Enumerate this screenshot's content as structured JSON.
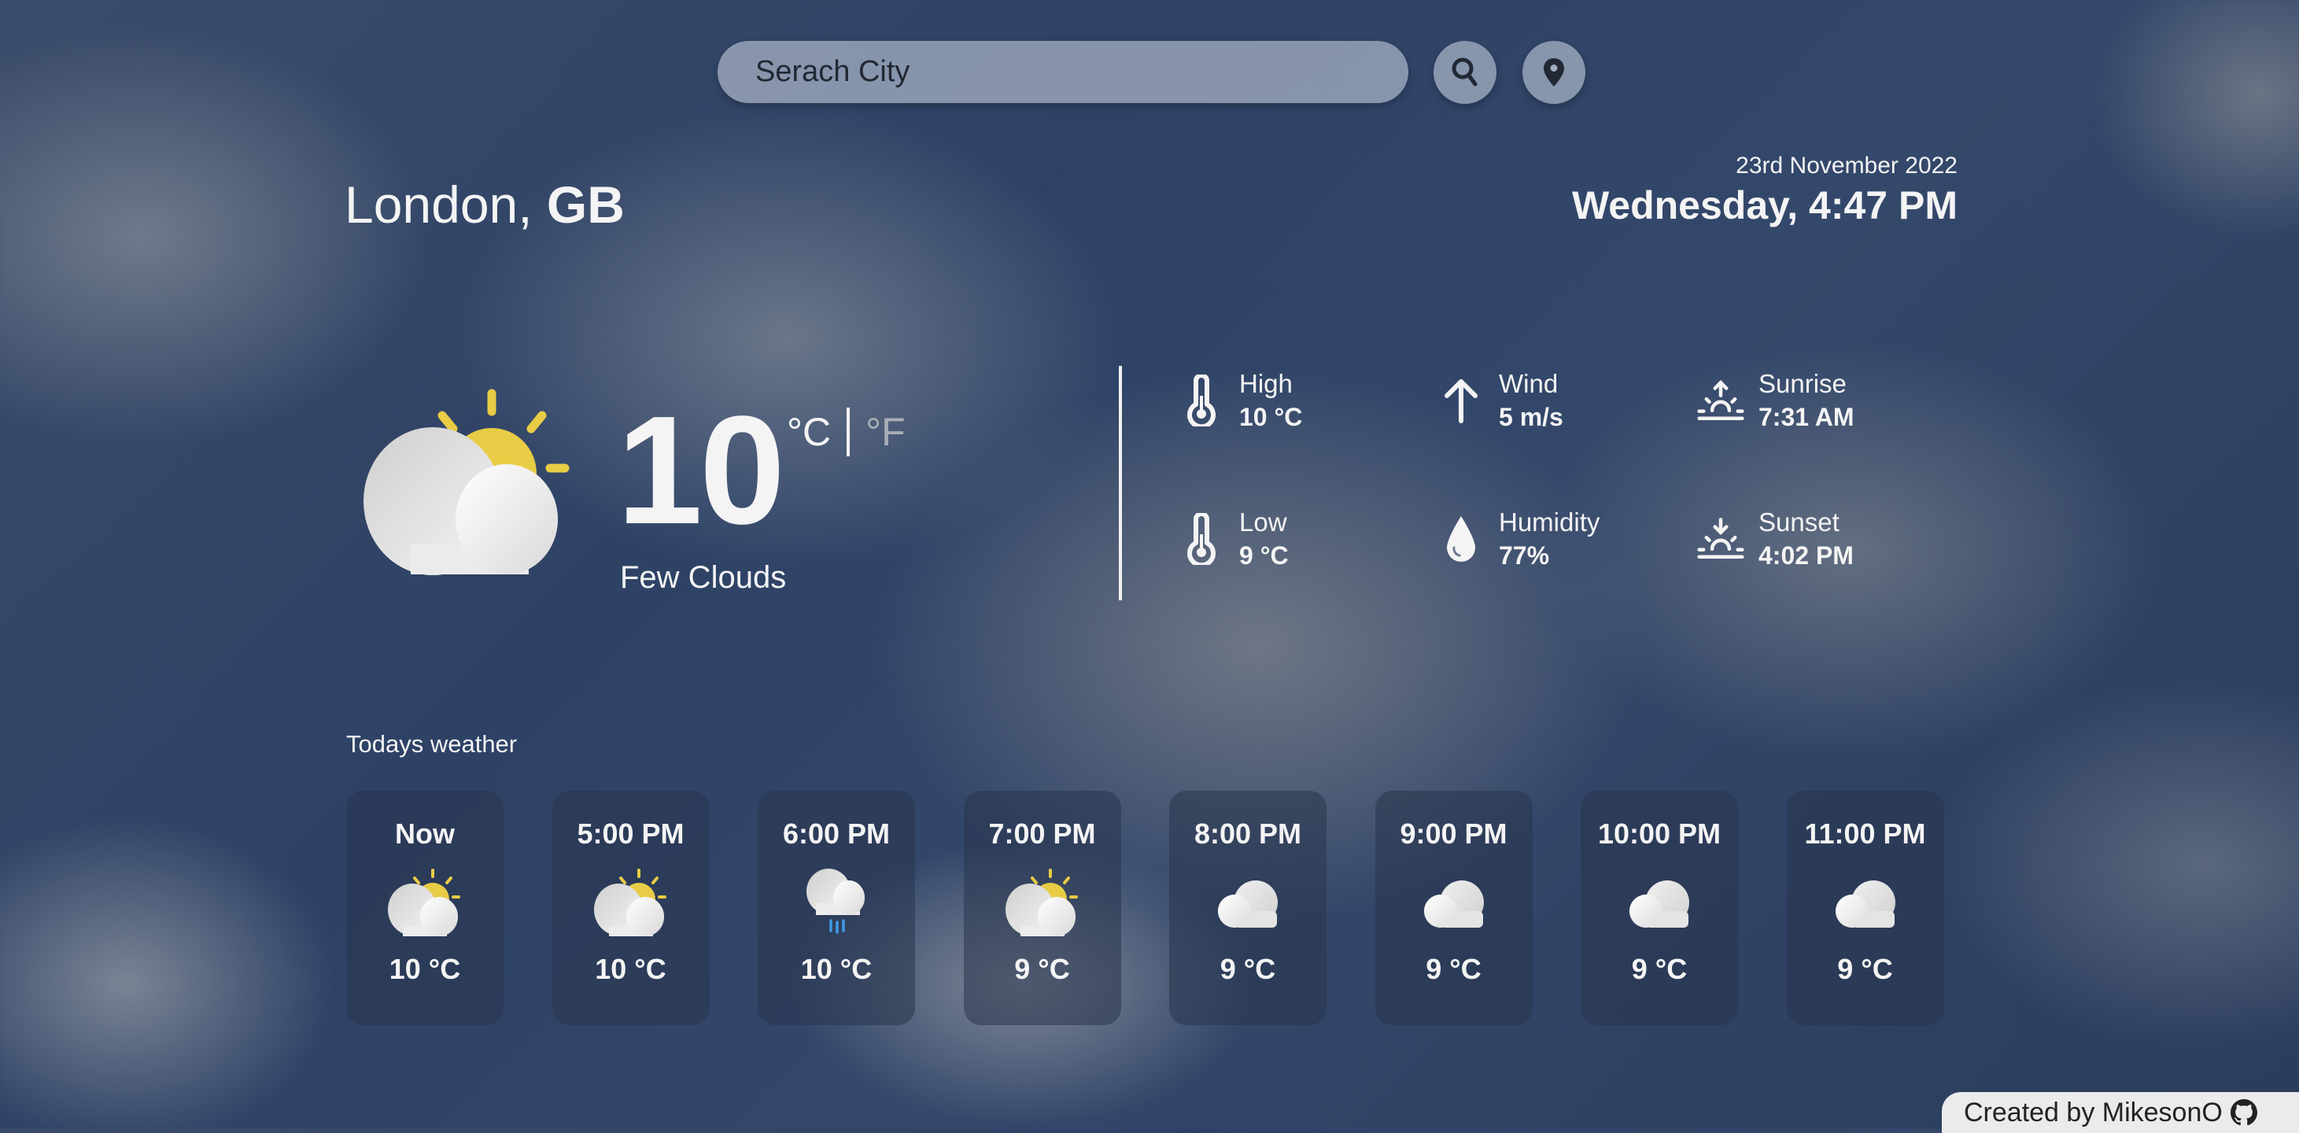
{
  "search": {
    "placeholder": "Serach City",
    "value": "",
    "search_icon": "search-icon",
    "location_icon": "location-pin-icon"
  },
  "location": {
    "city": "London,",
    "country": "GB"
  },
  "datetime": {
    "date": "23rd November 2022",
    "day_time": "Wednesday, 4:47 PM"
  },
  "current": {
    "icon": "partly-cloudy-day-icon",
    "temperature": "10",
    "unit_celsius": "°C",
    "unit_fahrenheit": "°F",
    "selected_unit": "celsius",
    "description": "Few Clouds"
  },
  "details": [
    {
      "icon": "thermometer-icon",
      "label": "High",
      "value": "10 °C"
    },
    {
      "icon": "wind-arrow-icon",
      "label": "Wind",
      "value": "5 m/s"
    },
    {
      "icon": "sunrise-icon",
      "label": "Sunrise",
      "value": "7:31 AM"
    },
    {
      "icon": "thermometer-icon",
      "label": "Low",
      "value": "9 °C"
    },
    {
      "icon": "humidity-drop-icon",
      "label": "Humidity",
      "value": "77%"
    },
    {
      "icon": "sunset-icon",
      "label": "Sunset",
      "value": "4:02 PM"
    }
  ],
  "hourly": {
    "title": "Todays weather",
    "items": [
      {
        "time": "Now",
        "icon": "partly-cloudy-icon",
        "temp": "10 °C"
      },
      {
        "time": "5:00 PM",
        "icon": "partly-cloudy-icon",
        "temp": "10 °C"
      },
      {
        "time": "6:00 PM",
        "icon": "rain-cloud-icon",
        "temp": "10 °C"
      },
      {
        "time": "7:00 PM",
        "icon": "partly-cloudy-icon",
        "temp": "9 °C"
      },
      {
        "time": "8:00 PM",
        "icon": "cloud-icon",
        "temp": "9 °C"
      },
      {
        "time": "9:00 PM",
        "icon": "cloud-icon",
        "temp": "9 °C"
      },
      {
        "time": "10:00 PM",
        "icon": "cloud-icon",
        "temp": "9 °C"
      },
      {
        "time": "11:00 PM",
        "icon": "cloud-icon",
        "temp": "9 °C"
      }
    ]
  },
  "footer": {
    "text": "Created by MikesonO",
    "icon": "github-icon"
  },
  "colors": {
    "sun": "#e8cc45",
    "rain": "#3f9be6",
    "text": "#f4f4f4",
    "unit_inactive": "#a9aeb6"
  }
}
